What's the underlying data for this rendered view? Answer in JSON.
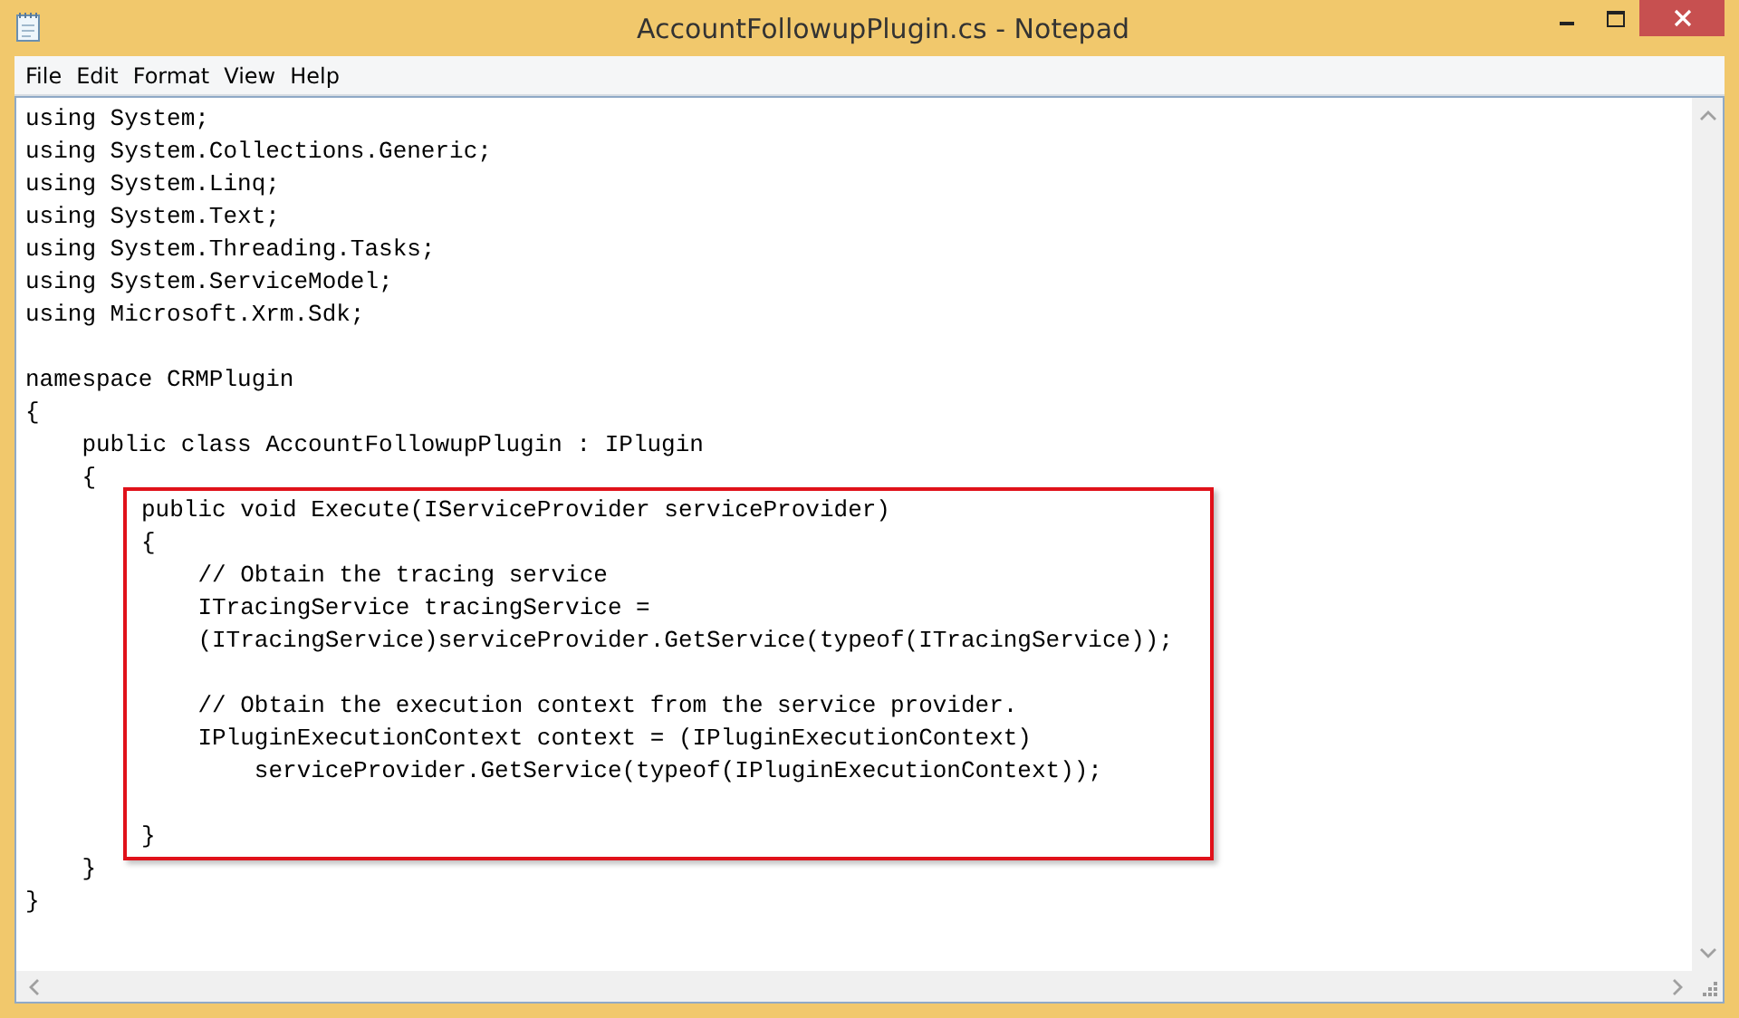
{
  "window": {
    "title": "AccountFollowupPlugin.cs - Notepad"
  },
  "menu": [
    {
      "label": "File"
    },
    {
      "label": "Edit"
    },
    {
      "label": "Format"
    },
    {
      "label": "View"
    },
    {
      "label": "Help"
    }
  ],
  "editor": {
    "paragraphs_before": [
      {
        "lines": [
          "using System;",
          "using System.Collections.Generic;",
          "using System.Linq;",
          "using System.Text;",
          "using System.Threading.Tasks;",
          "using System.ServiceModel;",
          "using Microsoft.Xrm.Sdk;"
        ]
      },
      {
        "lines": [
          "namespace CRMPlugin",
          "{",
          "    public class AccountFollowupPlugin : IPlugin",
          "    {"
        ]
      }
    ],
    "highlighted_paragraphs": [
      {
        "lines": [
          "public void Execute(IServiceProvider serviceProvider)",
          "{",
          "    // Obtain the tracing service",
          "    ITracingService tracingService =",
          "    (ITracingService)serviceProvider.GetService(typeof(ITracingService));"
        ]
      },
      {
        "lines": [
          "    // Obtain the execution context from the service provider.",
          "    IPluginExecutionContext context = (IPluginExecutionContext)",
          "        serviceProvider.GetService(typeof(IPluginExecutionContext));"
        ]
      },
      {
        "lines": [
          "}"
        ]
      }
    ],
    "lines_after": [
      "    }",
      "}"
    ]
  }
}
